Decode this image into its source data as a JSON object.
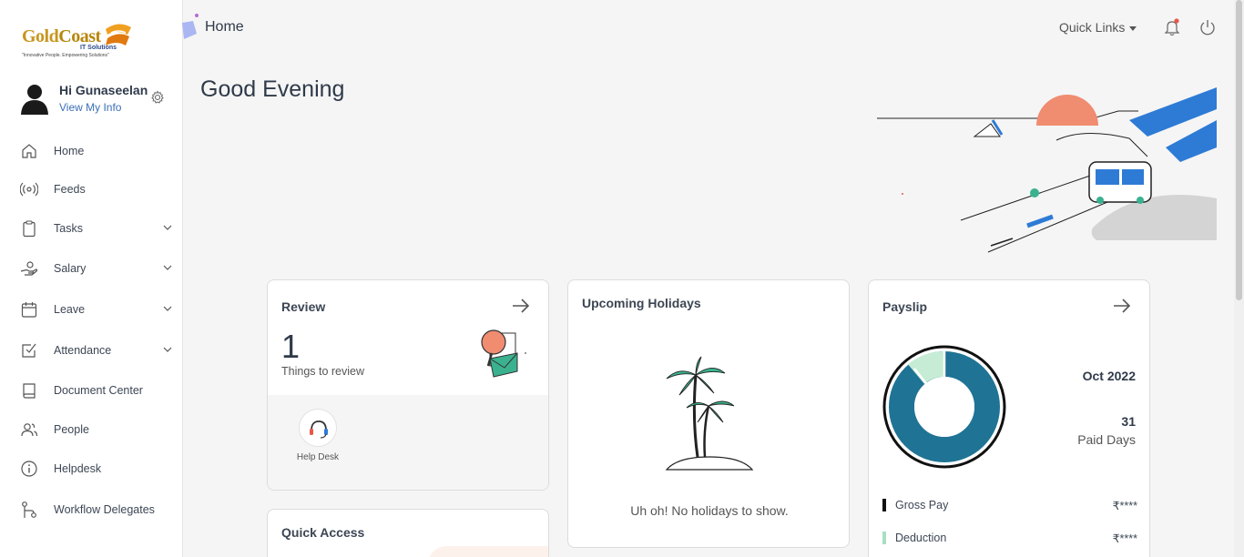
{
  "brand": {
    "name_part1": "Gold",
    "name_part2": "Coast",
    "sub": "IT Solutions",
    "tagline": "\"Innovative People. Empowering Solutions\""
  },
  "profile": {
    "greeting": "Hi Gunaseelan",
    "link": "View My Info"
  },
  "sidebar": {
    "items": [
      {
        "label": "Home",
        "icon": "home-icon",
        "expandable": false
      },
      {
        "label": "Feeds",
        "icon": "broadcast-icon",
        "expandable": false
      },
      {
        "label": "Tasks",
        "icon": "clipboard-icon",
        "expandable": true
      },
      {
        "label": "Salary",
        "icon": "hand-money-icon",
        "expandable": true
      },
      {
        "label": "Leave",
        "icon": "calendar-icon",
        "expandable": true
      },
      {
        "label": "Attendance",
        "icon": "checkbox-icon",
        "expandable": true
      },
      {
        "label": "Document Center",
        "icon": "book-icon",
        "expandable": false
      },
      {
        "label": "People",
        "icon": "people-icon",
        "expandable": false
      },
      {
        "label": "Helpdesk",
        "icon": "info-icon",
        "expandable": false
      },
      {
        "label": "Workflow Delegates",
        "icon": "workflow-icon",
        "expandable": false
      }
    ]
  },
  "header": {
    "title": "Home",
    "quick_links": "Quick Links"
  },
  "main": {
    "greeting": "Good Evening",
    "review": {
      "title": "Review",
      "count": "1",
      "subtitle": "Things to review",
      "helpdesk_label": "Help Desk"
    },
    "holidays": {
      "title": "Upcoming Holidays",
      "empty_message": "Uh oh! No holidays to show."
    },
    "payslip": {
      "title": "Payslip",
      "month": "Oct 2022",
      "paid_days": "31",
      "paid_days_label": "Paid Days",
      "rows": [
        {
          "label": "Gross Pay",
          "value": "₹****",
          "color": "#111111"
        },
        {
          "label": "Deduction",
          "value": "₹****",
          "color": "#a8e0c0"
        }
      ],
      "chart_colors": {
        "main": "#1f7395",
        "secondary": "#c7ecd5"
      }
    },
    "quick_access": {
      "title": "Quick Access"
    }
  },
  "colors": {
    "accent": "#3b6fb6",
    "background": "#f5f5f5",
    "notification_dot": "#e8574a"
  }
}
